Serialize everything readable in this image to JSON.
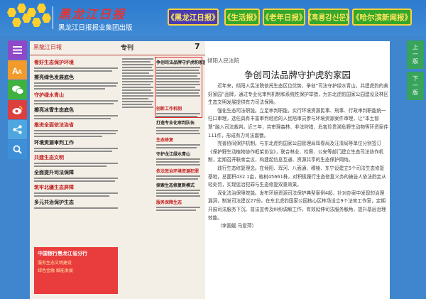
{
  "brand": {
    "title": "黑龙江日报",
    "subtitle": "黑龙江日报报业集团出版",
    "hex_color": "#ffcf2e",
    "title_color": "#e23434"
  },
  "nav": [
    {
      "label": "《黑龙江日报》",
      "active": true
    },
    {
      "label": "《生活报》"
    },
    {
      "label": "《老年日报》"
    },
    {
      "label": "《흑룡강신문》"
    },
    {
      "label": "《哈尔滨新闻报》"
    }
  ],
  "toolbar": {
    "menu_icon": "menu-icon",
    "font_icon": "font-size-icon",
    "wechat_icon": "wechat-icon",
    "weibo_icon": "weibo-icon",
    "share_icon": "share-icon",
    "search_icon": "search-icon"
  },
  "paper": {
    "logo": "黑龍江日報",
    "section": "专刊",
    "page_number": "7",
    "headlines_left": [
      "看好生态保护环境",
      "擦亮绿色发展底色",
      "守护绿水青山",
      "擦亮冰雪生态底色",
      "推进全面依法治省",
      "环境资源审判工作",
      "共建生态文明",
      "全面提升司法保障",
      "筑牢北疆生态屏障",
      "多元共治保护生态"
    ],
    "headlines_right": [
      "创新工作机制",
      "打造专业化审判队伍",
      "生态修复",
      "守护龙江绿水青山",
      "依法惩治环境资源犯罪",
      "探索生态修复新模式",
      "服务保障生态"
    ],
    "boxed_headline": "争创司法品牌守护虎豹家园",
    "banner_title": "中国银行黑龙江省分行",
    "banner_lines": [
      "服务生态文明建设",
      "绿色金融 赋能发展"
    ]
  },
  "article": {
    "column": "倾阳人民法院",
    "title": "争创司法品牌守护虎豹家园",
    "paragraphs": [
      "近年来，倾阳人民法院依托生态区位优势，争创“司法守护绿水青山，共建虎豹的美好家园”品牌，通过专业化审判机制和系统性保护举措，为东北虎豹国家公园建设及林区生态文明发展提供有力司法保障。",
      "强化生态司法职能。立足审判职能，实行环境资源民事、刑事、行政审判职能统一归口审理，选任具有丰富审判经验的人民陪审员参与环境资源案件审理，让“本土智慧”融入司法裁判。近三年，共审理森林、非法狩猎、危害珍贵濒危野生动物等环资案件111件，形成有力司法震慑。",
      "完善协同保护机制。与东北虎豹国家公园管理局珲春局及汪清局等单位分别签订《保护野生动植物协作框架协议》，联合林业、检察、公安等部门建立生态司法协作机制，定期召开联席会议，构建起信息互通、资源共享的生态保护网络。",
      "践行生态修复理念。在倾阳、珲河、八面通、穆棱、东宁设建立5个司法生态修复基地，总面积432.1亩，植树45661株，对积极履行生态修复义务的被告人依法酌定从轻处罚，实现惩治犯罪与生态修复双重效果。",
      "深化法治保障效能。发布环境资源司法保护典型案例4起，针对办案中发现的治理漏洞，制发司法建议27份。在东北虎豹国家公园核心区林场设立9个法官工作室，定期开展司法服务下沉、普法宣传及纠纷调解工作，有效延伸司法服务触角，提升基层治理效能。",
      "（李圆媛 马爱萍）"
    ]
  },
  "page_buttons": {
    "prev": [
      "上",
      "一",
      "版"
    ],
    "next": [
      "下",
      "一",
      "版"
    ]
  }
}
